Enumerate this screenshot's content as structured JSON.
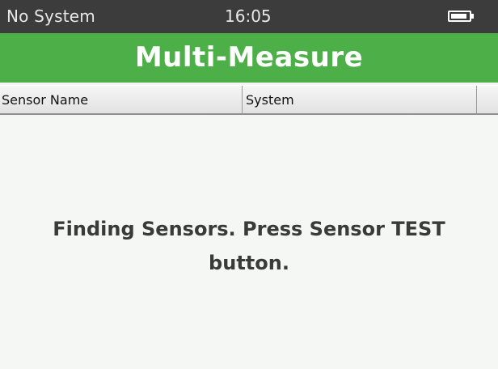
{
  "status_bar": {
    "system_status": "No System",
    "time": "16:05",
    "battery_icon": "battery-full-icon",
    "battery_level": 0.9
  },
  "app": {
    "title": "Multi-Measure"
  },
  "table": {
    "columns": [
      "Sensor Name",
      "System",
      ""
    ]
  },
  "main": {
    "message": "Finding Sensors. Press Sensor TEST button."
  },
  "colors": {
    "status_bar_bg": "#3c3c3c",
    "title_bar_bg": "#4caf47",
    "content_bg": "#f4f7f4",
    "message_text": "#3a3a3a"
  }
}
